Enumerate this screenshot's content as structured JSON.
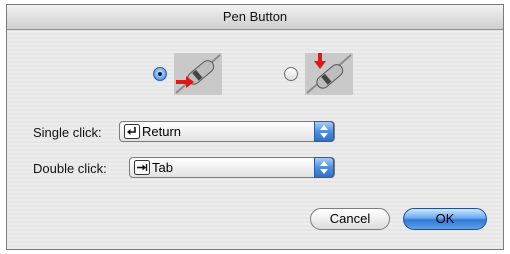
{
  "dialog": {
    "title": "Pen Button"
  },
  "options": {
    "selected": "option-1",
    "icons": [
      "pen-button-side-icon",
      "pen-button-top-icon"
    ]
  },
  "single_click": {
    "label": "Single click:",
    "value": "Return",
    "icon": "return-key-icon"
  },
  "double_click": {
    "label": "Double click:",
    "value": "Tab",
    "icon": "tab-key-icon"
  },
  "buttons": {
    "cancel": "Cancel",
    "ok": "OK"
  },
  "colors": {
    "accent": "#3a7bd5",
    "arrow": "#e01818"
  }
}
